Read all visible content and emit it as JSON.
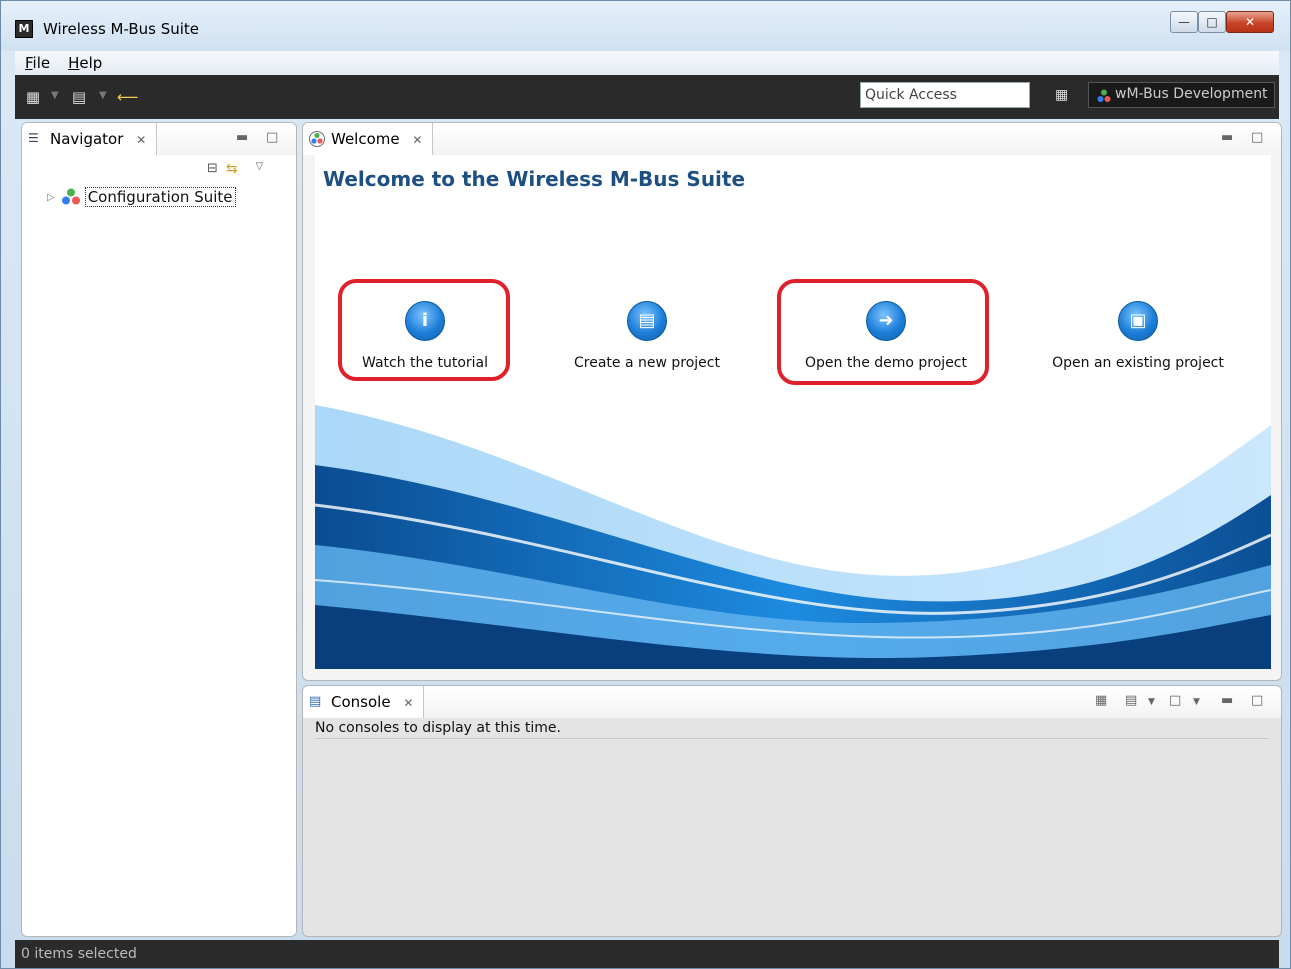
{
  "window": {
    "title": "Wireless M-Bus Suite"
  },
  "menu": {
    "items": [
      {
        "accel": "F",
        "rest": "ile"
      },
      {
        "accel": "H",
        "rest": "elp"
      }
    ]
  },
  "toolbar": {
    "quick_access_placeholder": "Quick Access",
    "perspective_label": "wM-Bus Development"
  },
  "navigator": {
    "tab_label": "Navigator",
    "tree": [
      {
        "label": "Configuration Suite"
      }
    ]
  },
  "welcome": {
    "tab_label": "Welcome",
    "heading": "Welcome to the Wireless M-Bus Suite",
    "actions": [
      {
        "label": "Watch the tutorial",
        "icon": "info-icon"
      },
      {
        "label": "Create a new project",
        "icon": "document-icon"
      },
      {
        "label": "Open the demo project",
        "icon": "arrow-right-icon"
      },
      {
        "label": "Open an existing project",
        "icon": "folder-icon"
      }
    ]
  },
  "console": {
    "tab_label": "Console",
    "message": "No consoles to display at this time."
  },
  "status": {
    "text": "0 items selected"
  },
  "colors": {
    "accent_blue": "#1d7ed8",
    "highlight_red": "#e0202a",
    "dark_bar": "#2a2a2a"
  }
}
